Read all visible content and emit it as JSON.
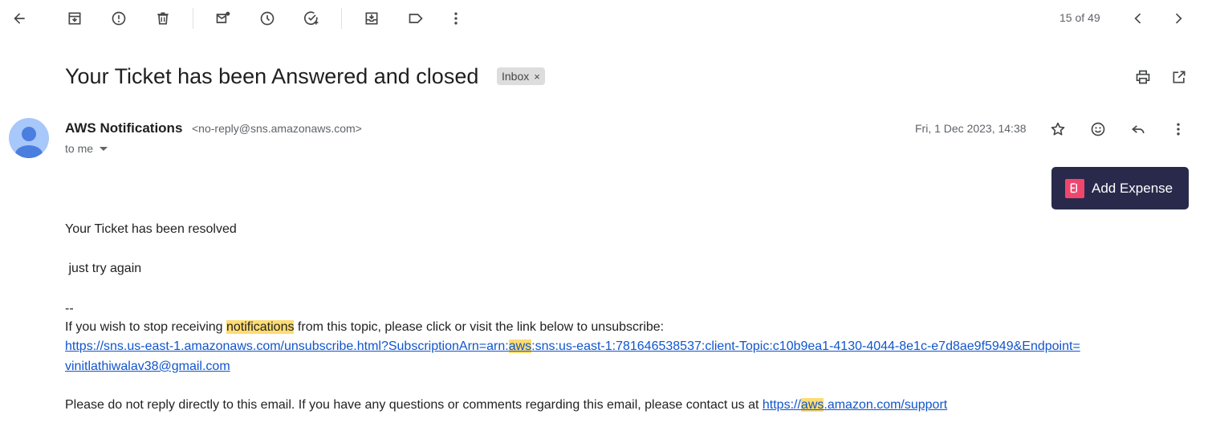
{
  "pager": {
    "text": "15 of 49"
  },
  "subject": {
    "title": "Your Ticket has been Answered and closed",
    "label": "Inbox",
    "label_remove": "×"
  },
  "sender": {
    "name": "AWS Notifications",
    "email": "<no-reply@sns.amazonaws.com>",
    "to": "to me",
    "date": "Fri, 1 Dec 2023, 14:38"
  },
  "extension": {
    "add_expense": "Add Expense"
  },
  "body": {
    "line1": "Your Ticket has been resolved",
    "line2": " just try again",
    "dashes": "--",
    "unsub_pre": "If you wish to stop receiving ",
    "unsub_hl": "notifications",
    "unsub_post": " from this topic, please click or visit the link below to unsubscribe:",
    "link_a": "https://sns.us-east-1.amazonaws.com/unsubscribe.html?SubscriptionArn=arn:",
    "link_hl": "aws",
    "link_b": ":sns:us-east-1:781646538537:client-Topic:c10b9ea1-4130-4044-8e1c-e7d8ae9f5949&Endpoint=",
    "link_line2": "vinitlathiwalav38@gmail.com",
    "footer_pre": "Please do not reply directly to this email. If you have any questions or comments regarding this email, please contact us at ",
    "footer_link_a": "https://",
    "footer_link_hl": "aws",
    "footer_link_b": ".amazon.com/support"
  },
  "icons": {
    "toolbar": [
      "back-icon",
      "archive-icon",
      "report-spam-icon",
      "delete-icon",
      "mark-unread-icon",
      "snooze-icon",
      "add-task-icon",
      "move-to-icon",
      "label-icon",
      "more-icon"
    ],
    "header": [
      "print-icon",
      "open-new-window-icon"
    ],
    "message": [
      "star-icon",
      "emoji-icon",
      "reply-icon",
      "more-vert-icon"
    ]
  },
  "colors": {
    "highlight": "#fddc72",
    "link": "#1155cc",
    "expense_bg": "#292a4b",
    "expense_logo": "#f0466e"
  }
}
